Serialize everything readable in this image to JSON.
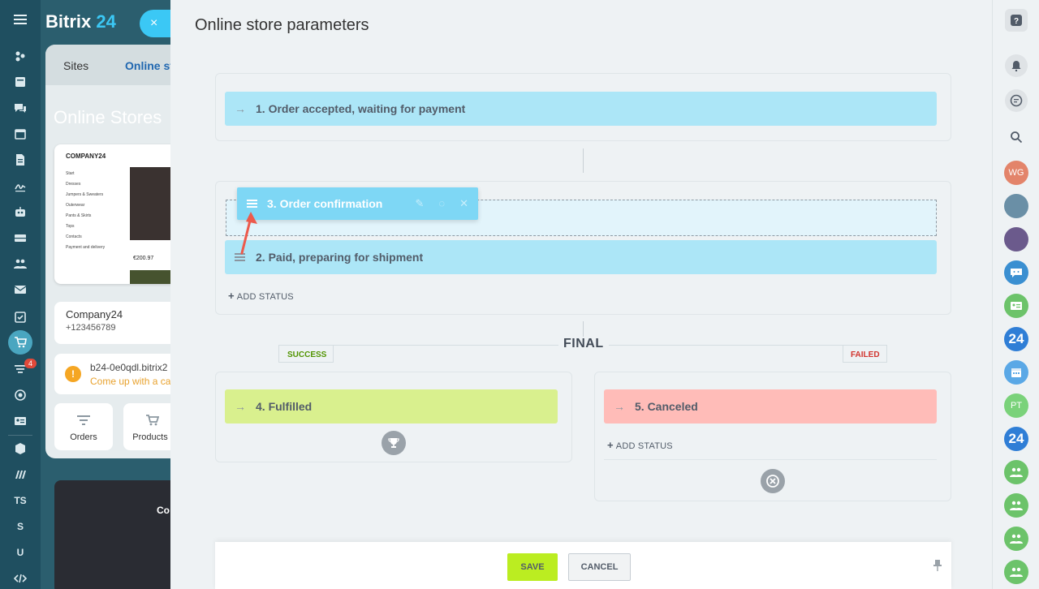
{
  "background": {
    "logo_text": "Bitrix",
    "logo_number": "24",
    "close_symbol": "×",
    "tabs": [
      "Sites",
      "Online st"
    ],
    "page_title": "Online Stores",
    "card": {
      "company": "COMPANY24",
      "menu": [
        "Start",
        "Dresses",
        "Jumpers & Sweaters",
        "Outerwear",
        "Pants & Skirts",
        "Tops",
        "Contacts",
        "Payment and delivery"
      ],
      "price": "€200.97"
    },
    "company_name": "Company24",
    "company_phone": "+123456789",
    "warning_line1": "b24-0e0qdl.bitrix2",
    "warning_line2": "Come up with a ca",
    "tiles": [
      "Orders",
      "Products"
    ],
    "dark_card_title": "Co"
  },
  "left_sidebar": {
    "text_items": [
      "TS",
      "S",
      "U"
    ],
    "cart_badge": "4"
  },
  "slider": {
    "title": "Online store parameters",
    "groups": {
      "start": {
        "statuses": [
          {
            "label": "1. Order accepted, waiting for payment",
            "color": "#ace6f7"
          }
        ]
      },
      "work": {
        "dragging": {
          "label": "3. Order confirmation",
          "color": "#7ed7f5"
        },
        "statuses": [
          {
            "label": "2. Paid, preparing for shipment",
            "color": "#ace6f7"
          }
        ],
        "add_status": "ADD STATUS"
      },
      "final": {
        "label": "FINAL",
        "success_label": "SUCCESS",
        "failed_label": "FAILED",
        "success_statuses": [
          {
            "label": "4. Fulfilled",
            "color": "#d9f08e"
          }
        ],
        "failed_statuses": [
          {
            "label": "5. Canceled",
            "color": "#ffbcb8"
          }
        ],
        "failed_add_status": "ADD STATUS"
      }
    },
    "footer": {
      "save_label": "SAVE",
      "cancel_label": "CANCEL"
    }
  },
  "right_sidebar": {
    "avatars": [
      {
        "initials": "WG",
        "color": "#e3846a"
      },
      {
        "initials": "",
        "color": "#6a8fa6"
      },
      {
        "initials": "",
        "color": "#6b5a8c"
      },
      {
        "initials": "",
        "color": "#3a8fd1",
        "icon": "chat-group-icon"
      },
      {
        "initials": "",
        "color": "#6cc36a",
        "icon": "contact-card-icon"
      },
      {
        "initials": "24",
        "color": "#2f7ed6"
      },
      {
        "initials": "",
        "color": "#5aa8e6",
        "icon": "calendar-icon"
      },
      {
        "initials": "PT",
        "color": "#7ad27a"
      },
      {
        "initials": "24",
        "color": "#2f7ed6"
      },
      {
        "initials": "",
        "color": "#6cc36a",
        "icon": "group-icon"
      },
      {
        "initials": "",
        "color": "#6cc36a",
        "icon": "group-icon"
      },
      {
        "initials": "",
        "color": "#6cc36a",
        "icon": "group-icon"
      },
      {
        "initials": "",
        "color": "#6cc36a",
        "icon": "group-icon"
      }
    ]
  },
  "colors": {
    "accent_blue": "#3bc8f5",
    "save_green": "#bbed21",
    "success_text": "#519400",
    "failed_text": "#d2342e"
  }
}
